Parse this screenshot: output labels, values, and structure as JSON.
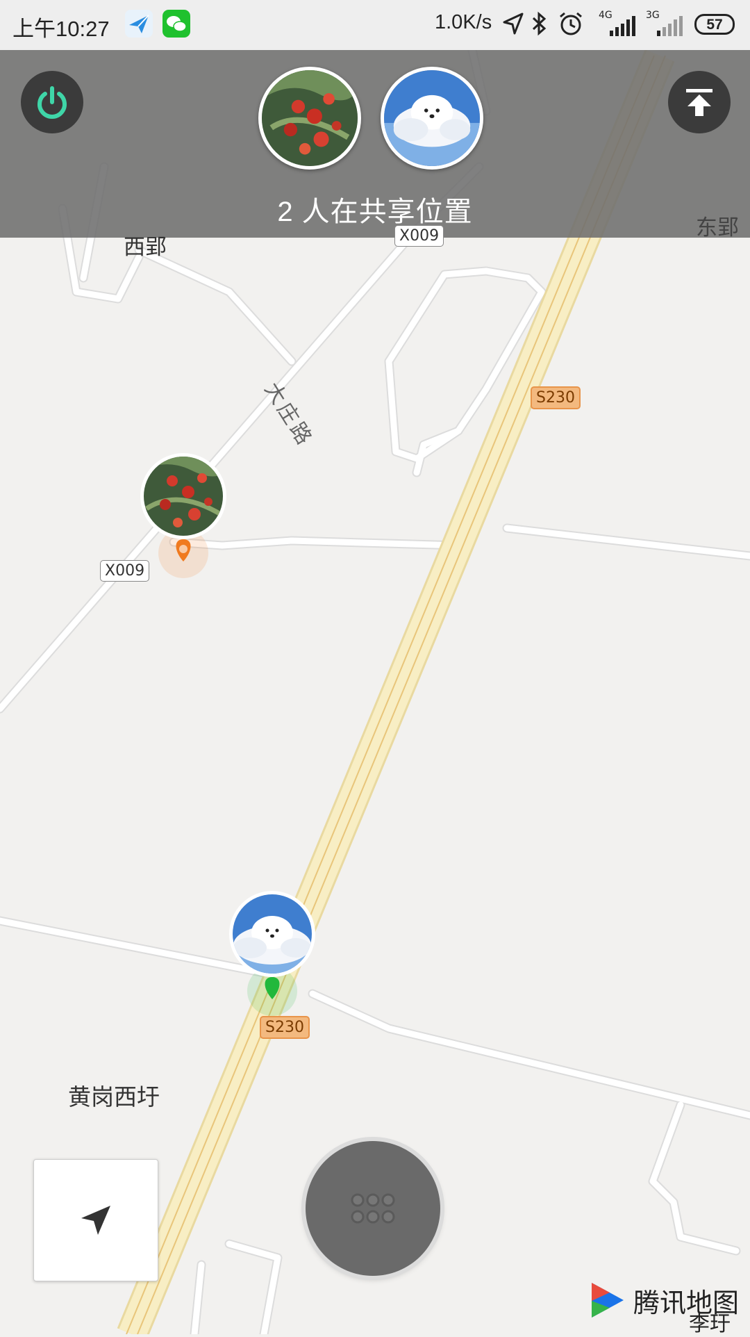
{
  "status_bar": {
    "time": "上午10:27",
    "net_speed": "1.0K/s",
    "network_1": "4G",
    "network_2": "3G",
    "battery": "57",
    "icons": [
      "send-app-icon",
      "wechat-icon",
      "location-arrow-icon",
      "bluetooth-icon",
      "alarm-icon",
      "signal-icon",
      "signal-icon"
    ]
  },
  "share_panel": {
    "count_text": "2 人在共享位置",
    "power_icon": "power-icon",
    "upload_icon": "collapse-up-icon",
    "participants": [
      {
        "avatar": "strawberry-avatar"
      },
      {
        "avatar": "cloud-dog-avatar"
      }
    ]
  },
  "map": {
    "place_labels": [
      "西郢",
      "东郢",
      "黄岗西圩"
    ],
    "road_names": [
      "大庄路"
    ],
    "road_badges": [
      "X009",
      "X009",
      "S230",
      "S230"
    ],
    "markers": [
      {
        "avatar": "strawberry-avatar",
        "color": "#f07a1f"
      },
      {
        "avatar": "cloud-dog-avatar",
        "color": "#22b83c"
      }
    ]
  },
  "controls": {
    "locate_icon": "navigation-arrow-icon",
    "menu_icon": "grid-dots-icon"
  },
  "brand": {
    "logo_text": "腾讯地图",
    "watermark": "李玗"
  },
  "colors": {
    "power_accent": "#3fd6a8",
    "highway": "#f6e9b0",
    "overlay": "#6e6e6e"
  }
}
